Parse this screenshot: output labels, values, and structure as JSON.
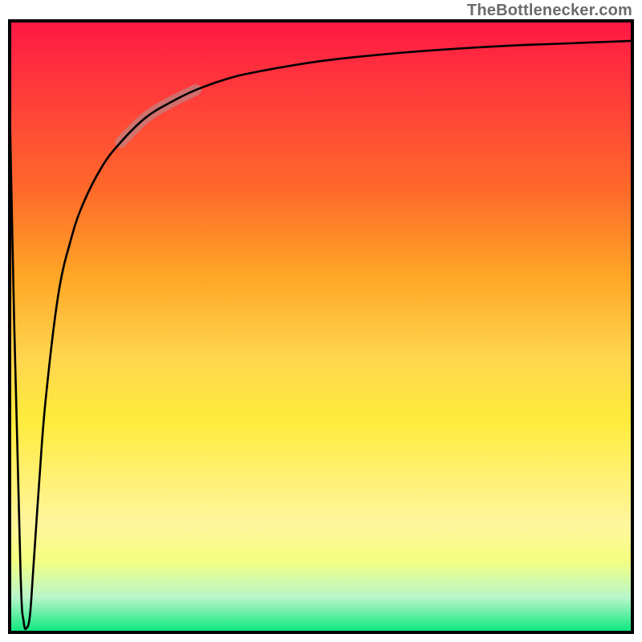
{
  "watermark": "TheBottlenecker.com",
  "chart_data": {
    "type": "line",
    "title": "",
    "xlabel": "",
    "ylabel": "",
    "xlim": [
      0,
      100
    ],
    "ylim": [
      0,
      100
    ],
    "series": [
      {
        "name": "curve",
        "x": [
          0,
          1,
          2,
          2.5,
          3,
          3.5,
          4,
          5,
          6,
          8,
          10,
          12,
          15,
          18,
          22,
          26,
          30,
          35,
          40,
          50,
          60,
          70,
          80,
          90,
          100
        ],
        "y": [
          100,
          50,
          10,
          2,
          1,
          3,
          10,
          25,
          38,
          55,
          64,
          70,
          76,
          80,
          84,
          86.5,
          88.5,
          90.3,
          91.5,
          93.2,
          94.3,
          95.1,
          95.7,
          96.1,
          96.5
        ]
      }
    ],
    "highlight_segment": {
      "x_start": 18,
      "x_end": 30
    },
    "colors": {
      "curve": "#000000",
      "highlight": "rgba(192,128,128,0.75)",
      "gradient_top": "#ff1744",
      "gradient_bottom": "#00e676"
    }
  }
}
